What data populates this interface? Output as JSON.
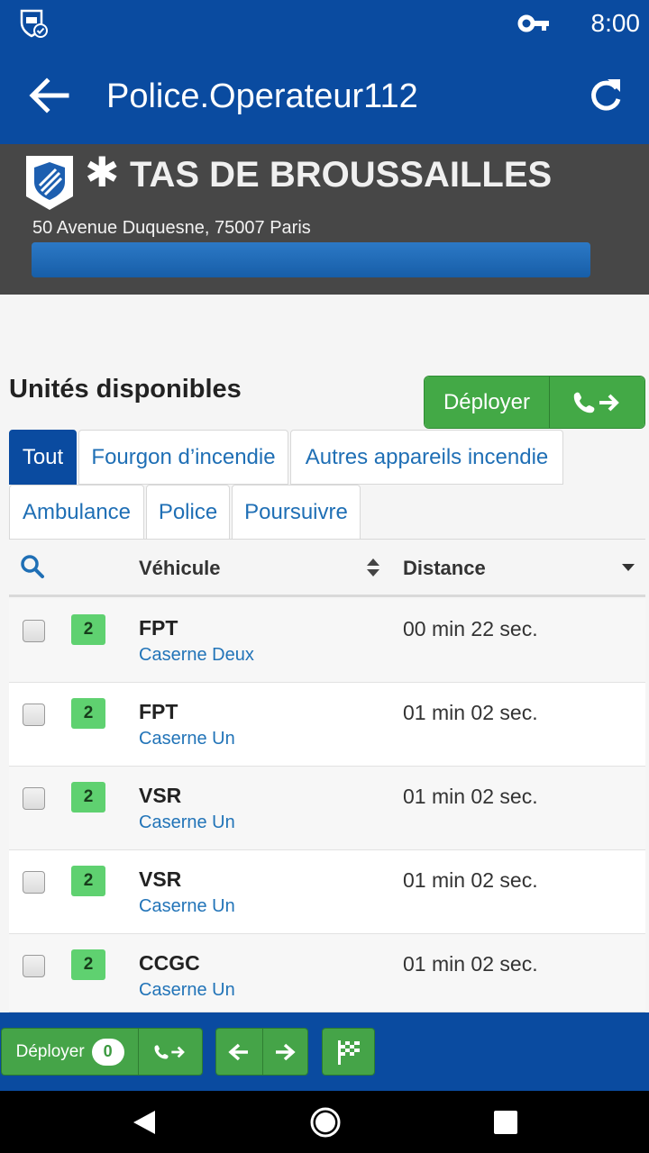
{
  "status_bar": {
    "time": "8:00",
    "icons": [
      "app-shield-icon",
      "vpn-key-icon"
    ]
  },
  "app_bar": {
    "title": "Police.Operateur112",
    "back_icon": "arrow-left-icon",
    "refresh_icon": "refresh-icon"
  },
  "incident": {
    "priority_symbol": "✱",
    "name": "TAS DE BROUSSAILLES",
    "address": "50 Avenue Duquesne, 75007 Paris",
    "progress": 1.0,
    "badge_icon": "police-shield-icon"
  },
  "units": {
    "title": "Unités disponibles",
    "deploy_label": "Déployer",
    "call_icon": "phone-arrow-icon"
  },
  "tabs": [
    {
      "label": "Tout",
      "active": true
    },
    {
      "label": "Fourgon d’incendie",
      "active": false
    },
    {
      "label": "Autres appareils incendie",
      "active": false
    },
    {
      "label": "Ambulance",
      "active": false
    },
    {
      "label": "Police",
      "active": false
    },
    {
      "label": "Poursuivre",
      "active": false
    }
  ],
  "table": {
    "col_vehicle": "Véhicule",
    "col_distance": "Distance",
    "rows": [
      {
        "crew": "2",
        "vehicle": "FPT",
        "station": "Caserne Deux",
        "distance": "00 min 22 sec.",
        "checked": false
      },
      {
        "crew": "2",
        "vehicle": "FPT",
        "station": "Caserne Un",
        "distance": "01 min 02 sec.",
        "checked": false
      },
      {
        "crew": "2",
        "vehicle": "VSR",
        "station": "Caserne Un",
        "distance": "01 min 02 sec.",
        "checked": false
      },
      {
        "crew": "2",
        "vehicle": "VSR",
        "station": "Caserne Un",
        "distance": "01 min 02 sec.",
        "checked": false
      },
      {
        "crew": "2",
        "vehicle": "CCGC",
        "station": "Caserne Un",
        "distance": "01 min 02 sec.",
        "checked": false
      }
    ]
  },
  "bottom_bar": {
    "deploy_label": "Déployer",
    "deploy_count": "0",
    "icons": [
      "phone-arrow-icon",
      "arrow-left-icon",
      "arrow-right-icon",
      "checkered-flag-icon"
    ]
  },
  "colors": {
    "primary": "#0a4ba0",
    "success": "#43a946",
    "incident_bg": "#474747",
    "link": "#2274b8",
    "crew_badge": "#5fd170"
  }
}
